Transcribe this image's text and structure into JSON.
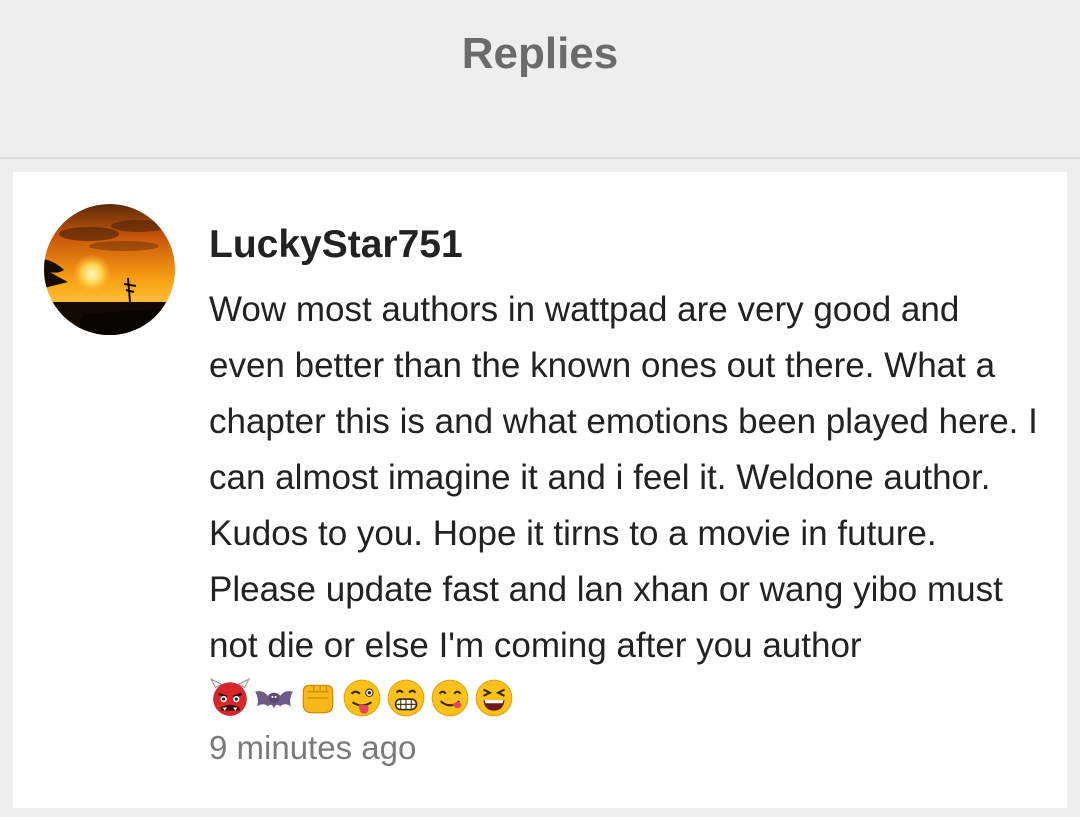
{
  "header": {
    "title": "Replies"
  },
  "reply": {
    "username": "LuckyStar751",
    "text": "Wow most authors in wattpad are very good and even better than the known ones out there. What a chapter this is and what emotions been played here. I can almost imagine it and i feel it. Weldone author. Kudos to you. Hope it tirns to a movie in future. Please update fast and lan xhan or wang yibo must not die or else I'm coming after you author",
    "emojis": [
      "ogre-emoji",
      "bat-emoji",
      "fist-emoji",
      "winking-tongue-emoji",
      "grinning-emoji",
      "yum-emoji",
      "squinting-laugh-emoji"
    ],
    "timestamp": "9 minutes ago",
    "avatar_icon": "sunset-avatar"
  },
  "colors": {
    "background": "#eeeeee",
    "card": "#ffffff",
    "header_text": "#6b6b6b",
    "body_text": "#222222",
    "timestamp_text": "#7a7a7a"
  }
}
